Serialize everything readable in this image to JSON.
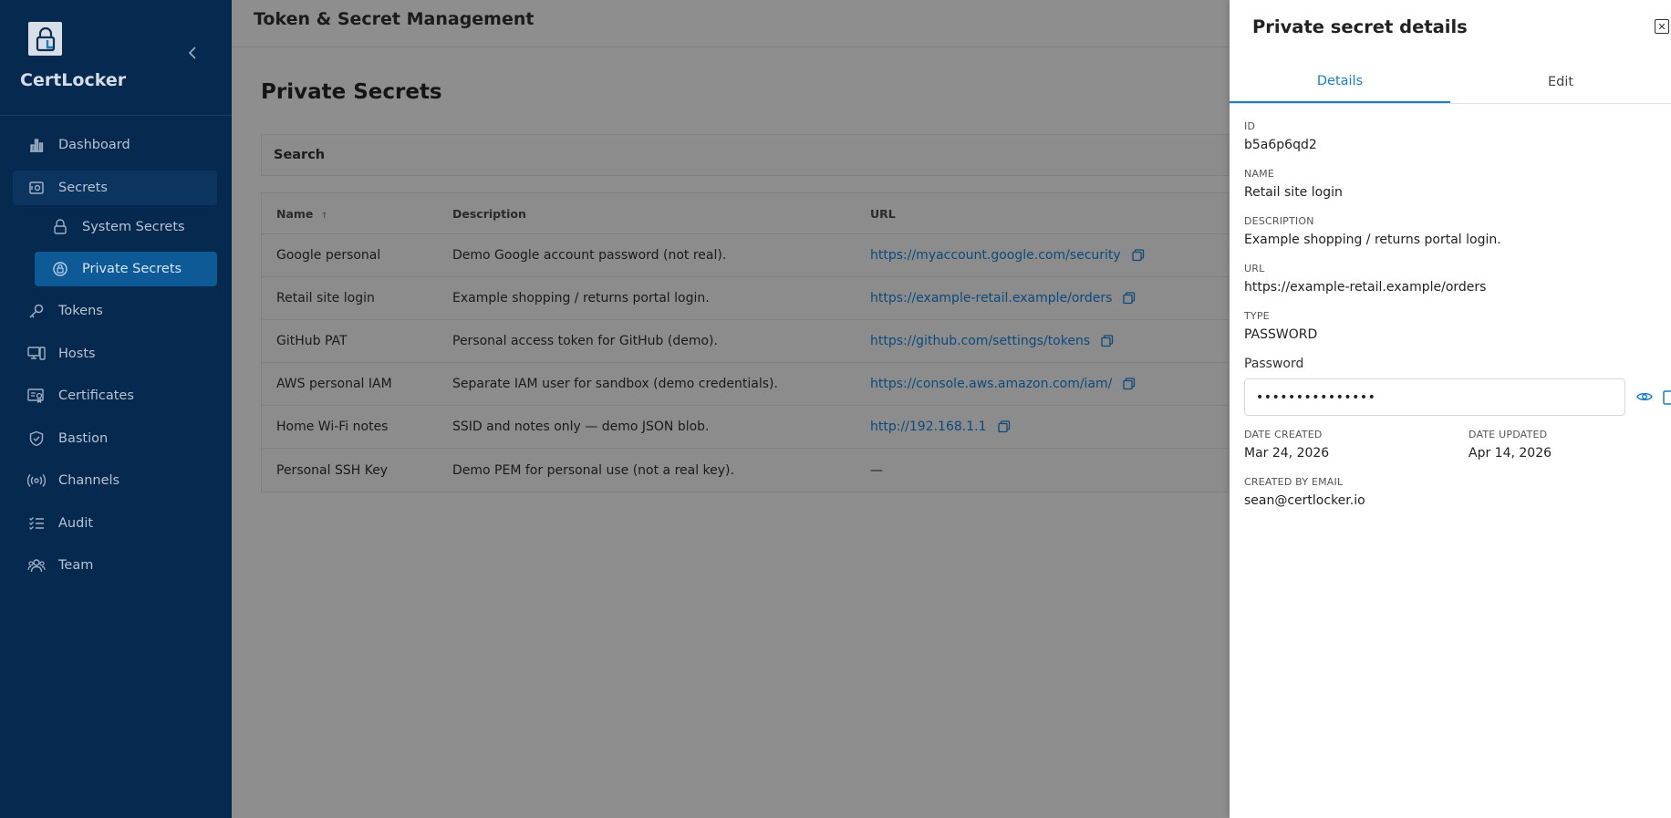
{
  "app": {
    "name": "CertLocker"
  },
  "sidebar": {
    "items": [
      {
        "label": "Dashboard",
        "icon": "bar-chart-icon"
      },
      {
        "label": "Secrets",
        "icon": "vault-icon"
      },
      {
        "label": "System Secrets",
        "icon": "lock-icon"
      },
      {
        "label": "Private Secrets",
        "icon": "lock-circle-icon"
      },
      {
        "label": "Tokens",
        "icon": "key-icon"
      },
      {
        "label": "Hosts",
        "icon": "server-icon"
      },
      {
        "label": "Certificates",
        "icon": "certificate-icon"
      },
      {
        "label": "Bastion",
        "icon": "shield-icon"
      },
      {
        "label": "Channels",
        "icon": "broadcast-icon"
      },
      {
        "label": "Audit",
        "icon": "list-check-icon"
      },
      {
        "label": "Team",
        "icon": "users-icon"
      }
    ]
  },
  "header": {
    "title": "Token & Secret Management"
  },
  "main": {
    "page_title": "Private Secrets",
    "search_label": "Search",
    "table": {
      "columns": [
        "Name",
        "Description",
        "URL"
      ],
      "sort_indicator": "↑",
      "rows": [
        {
          "name": "Google personal",
          "description": "Demo Google account password (not real).",
          "url": "https://myaccount.google.com/security"
        },
        {
          "name": "Retail site login",
          "description": "Example shopping / returns portal login.",
          "url": "https://example-retail.example/orders"
        },
        {
          "name": "GitHub PAT",
          "description": "Personal access token for GitHub (demo).",
          "url": "https://github.com/settings/tokens"
        },
        {
          "name": "AWS personal IAM",
          "description": "Separate IAM user for sandbox (demo credentials).",
          "url": "https://console.aws.amazon.com/iam/"
        },
        {
          "name": "Home Wi-Fi notes",
          "description": "SSID and notes only — demo JSON blob.",
          "url": "http://192.168.1.1"
        },
        {
          "name": "Personal SSH Key",
          "description": "Demo PEM for personal use (not a real key).",
          "url": "—"
        }
      ]
    }
  },
  "drawer": {
    "title": "Private secret details",
    "close_symbol": "✕",
    "tabs": [
      {
        "label": "Details",
        "active": true
      },
      {
        "label": "Edit",
        "active": false
      }
    ],
    "fields": {
      "id": {
        "label": "ID",
        "value": "b5a6p6qd2"
      },
      "name": {
        "label": "NAME",
        "value": "Retail site login"
      },
      "description": {
        "label": "DESCRIPTION",
        "value": "Example shopping / returns portal login."
      },
      "url": {
        "label": "URL",
        "value": "https://example-retail.example/orders"
      },
      "type": {
        "label": "TYPE",
        "value": "PASSWORD"
      },
      "date_created": {
        "label": "DATE CREATED",
        "value": "Mar 24, 2026"
      },
      "date_updated": {
        "label": "DATE UPDATED",
        "value": "Apr 14, 2026"
      },
      "created_by": {
        "label": "CREATED BY EMAIL",
        "value": "sean@certlocker.io"
      }
    },
    "password": {
      "label": "Password",
      "masked_value": "•••••••••••••••"
    }
  },
  "colors": {
    "sidebar_bg": "#06294f",
    "selected_nav": "#0d5a96",
    "accent": "#1a7fc1",
    "link": "#0b4a7a"
  }
}
